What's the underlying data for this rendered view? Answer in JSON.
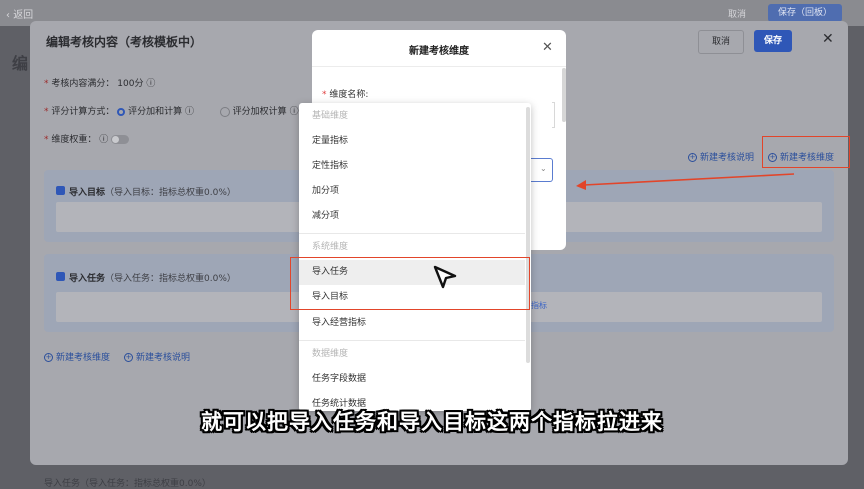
{
  "background": {
    "back_label": "返回",
    "cancel_label": "取消",
    "save_label": "保存（回板）",
    "edge_char": "编",
    "bottom_text": "导入任务（导入任务：指标总权重0.0%）"
  },
  "card": {
    "title": "编辑考核内容（考核模板中）",
    "cancel_label": "取消",
    "save_label": "保存",
    "total_label": "考核内容满分：",
    "total_value": "100分",
    "calc_label": "评分计算方式：",
    "calc_option_1": "评分加和计算",
    "calc_option_2": "评分加权计算",
    "weight_label": "维度权重：",
    "link_new_desc_top": "新建考核说明",
    "link_new_dim_top": "新建考核维度",
    "section_1_title": "导入目标",
    "section_1_sub": "（导入目标：指标总权重0.0%）",
    "section_2_title": "导入任务",
    "section_2_sub": "（导入任务：指标总权重0.0%）",
    "link_new_dim_bottom": "新建考核维度",
    "link_new_desc_bottom": "新建考核说明"
  },
  "modal": {
    "title": "新建考核维度",
    "name_label": "维度名称:"
  },
  "dropdown": {
    "group_basic": "基础维度",
    "items_basic": [
      "定量指标",
      "定性指标",
      "加分项",
      "减分项"
    ],
    "group_system": "系统维度",
    "items_system": [
      "导入任务",
      "导入目标",
      "导入经营指标"
    ],
    "group_data": "数据维度",
    "items_data": [
      "任务字段数据",
      "任务统计数据"
    ]
  },
  "stray_link": "指标",
  "subtitle": "就可以把导入任务和导入目标这两个指标拉进来",
  "colors": {
    "accent": "#2f57b7",
    "highlight": "#e2452a"
  }
}
